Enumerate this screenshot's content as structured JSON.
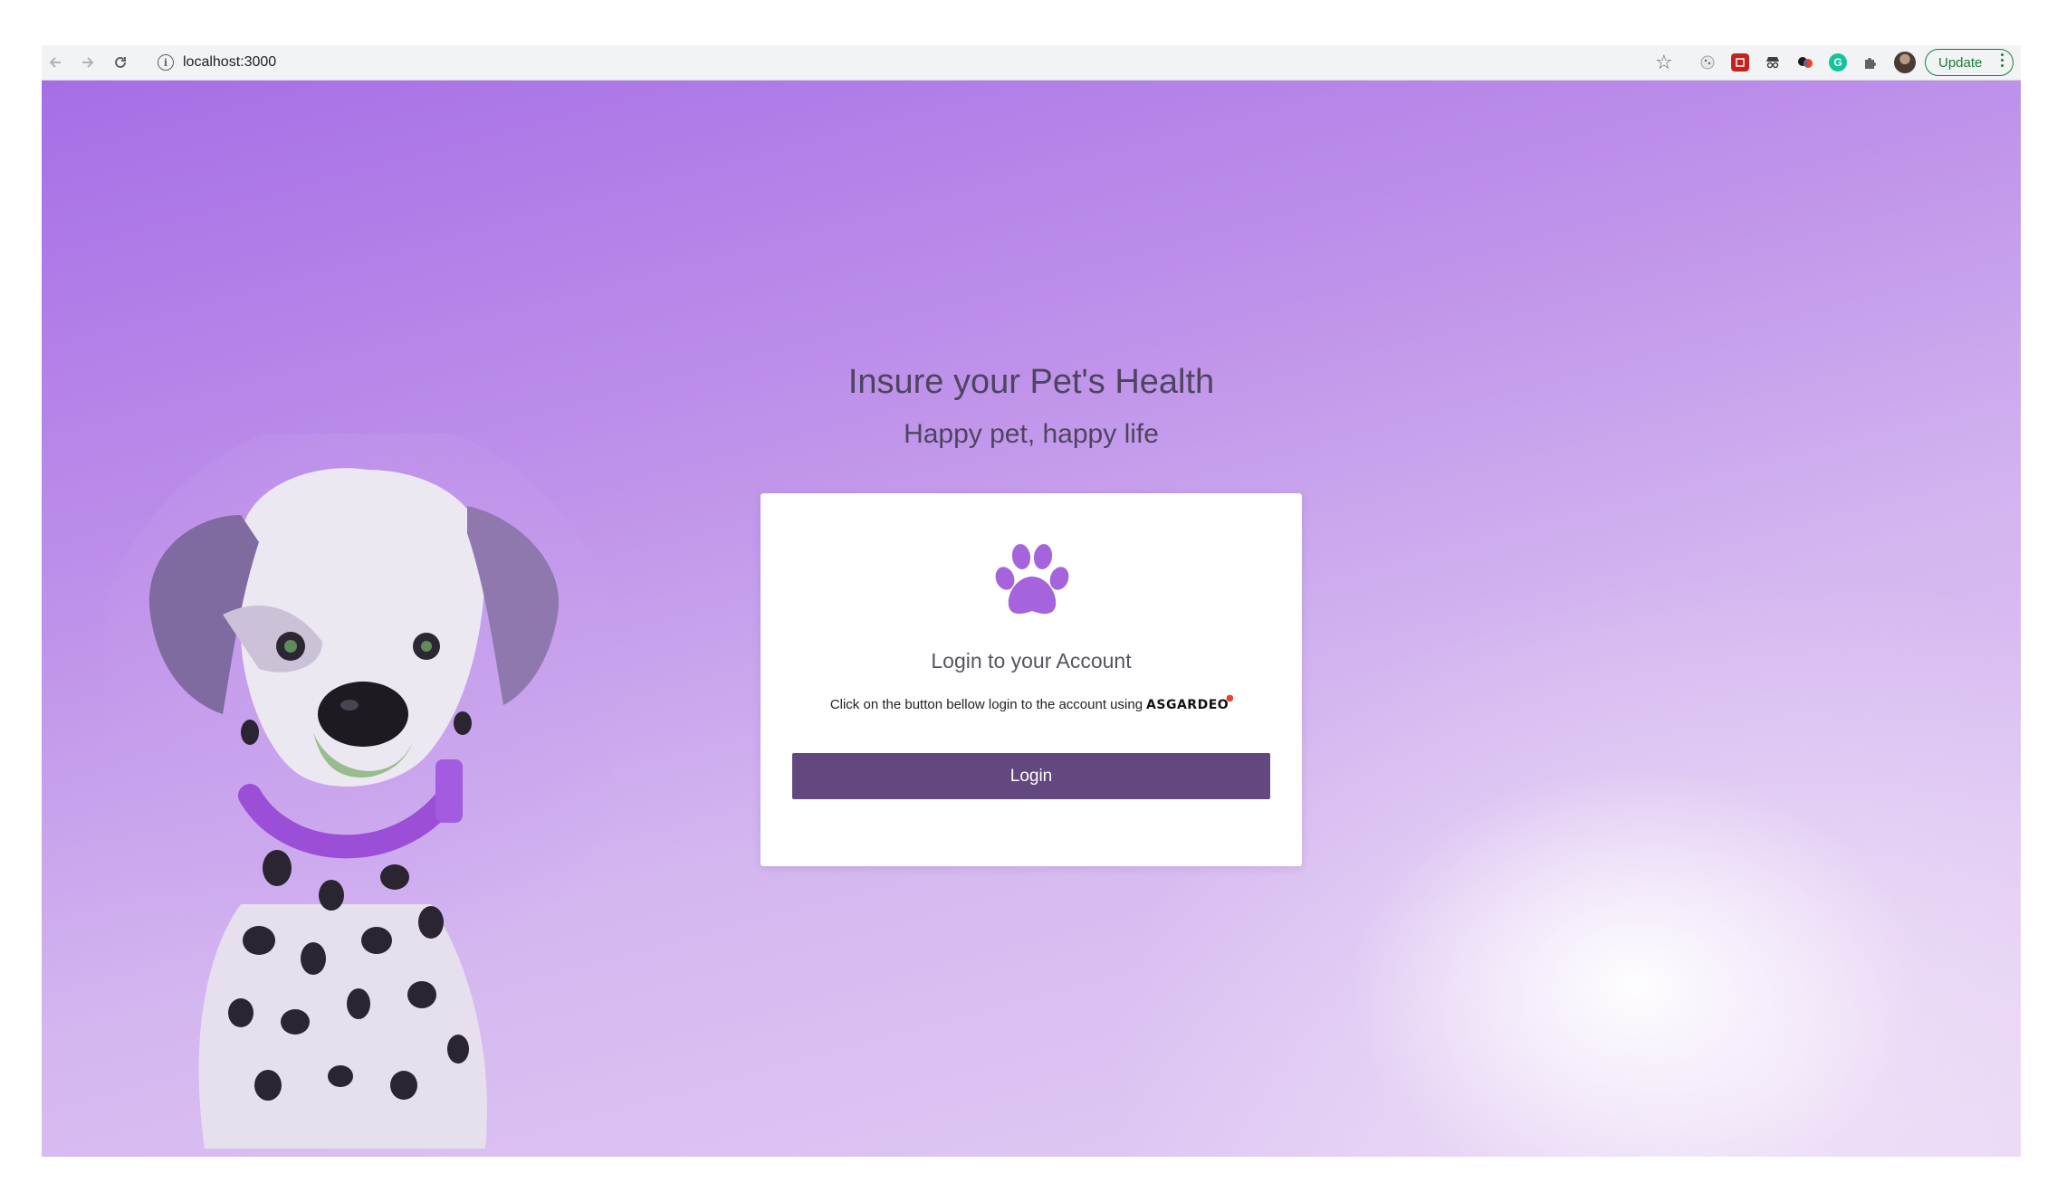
{
  "browser": {
    "url": "localhost:3000",
    "update_label": "Update",
    "icons": {
      "back": "arrow-left-icon",
      "forward": "arrow-right-icon",
      "reload": "reload-icon",
      "site_info": "info-icon",
      "bookmark": "star-icon",
      "extensions": "puzzle-icon"
    }
  },
  "hero": {
    "title": "Insure your Pet's Health",
    "subtitle": "Happy pet, happy life"
  },
  "card": {
    "title": "Login to your Account",
    "description": "Click on the button bellow login to the account using",
    "brand": "ASGARDEO",
    "login_label": "Login"
  },
  "colors": {
    "accent": "#63477f",
    "paw": "#a564dc",
    "background_start": "#a66ee6",
    "background_end": "#e4d0f4"
  }
}
